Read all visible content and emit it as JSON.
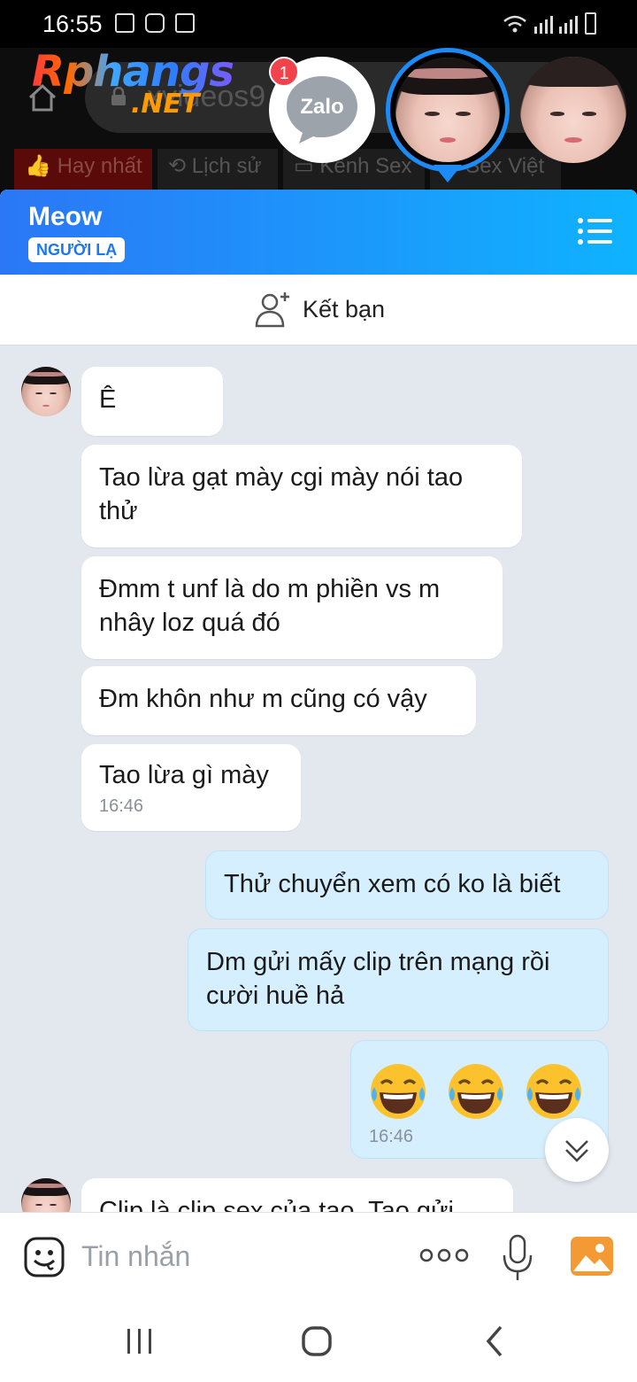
{
  "status_bar": {
    "time": "16:55"
  },
  "browser_bg": {
    "logo_top": "Rphangs",
    "logo_bottom": ".NET",
    "url": "xvideos9",
    "tab_count": "1",
    "chips": [
      "Hay nhất",
      "Lịch sử",
      "Kênh Sex",
      "Sex Việt"
    ]
  },
  "chat_heads": {
    "zalo_label": "Zalo",
    "zalo_badge": "1"
  },
  "chat": {
    "contact_name": "Meow",
    "stranger_tag": "NGƯỜI LẠ",
    "add_friend_label": "Kết bạn",
    "messages": [
      {
        "side": "in",
        "text": "Ê"
      },
      {
        "side": "in",
        "text": "Tao lừa gạt mày cgi mày nói tao thử"
      },
      {
        "side": "in",
        "text": "Đmm t unf là do m phiền vs m nhây loz quá đó"
      },
      {
        "side": "in",
        "text": "Đm khôn như m cũng có vậy"
      },
      {
        "side": "in",
        "text": "Tao lừa gì mày",
        "time": "16:46"
      },
      {
        "side": "out",
        "text": "Thử chuyển xem có ko là biết"
      },
      {
        "side": "out",
        "text": "Dm gửi mấy clip trên mạng rồi cười huề hả"
      },
      {
        "side": "out",
        "emoji": [
          "😂",
          "😂",
          "😂"
        ],
        "time": "16:46"
      },
      {
        "side": "in",
        "text": "Clip là clip sex của tao. Tao gửi"
      }
    ],
    "input_placeholder": "Tin nhắn"
  },
  "colors": {
    "header_start": "#2b77f6",
    "header_end": "#0fb3ff",
    "outgoing_bubble": "#d5efff",
    "chat_background": "#e3e8ee",
    "badge": "#f0434c"
  }
}
